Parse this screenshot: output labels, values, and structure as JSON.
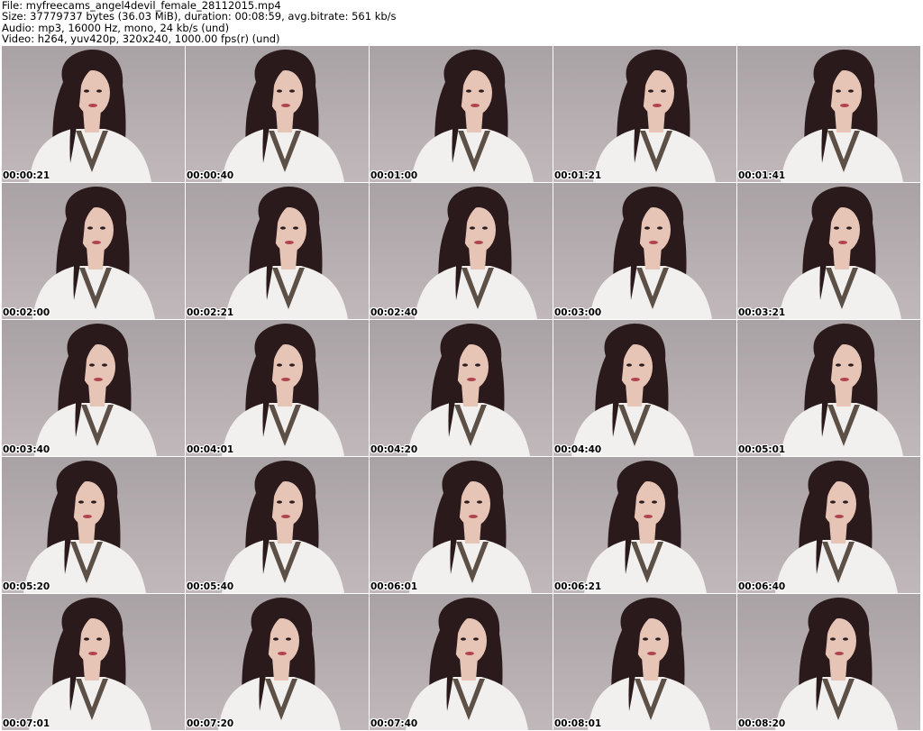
{
  "header": {
    "file": "File: myfreecams_angel4devil_female_28112015.mp4",
    "size": "Size: 37779737 bytes (36.03 MiB), duration: 00:08:59, avg.bitrate: 561 kb/s",
    "audio": "Audio: mp3, 16000 Hz, mono, 24 kb/s (und)",
    "video": "Video: h264, yuv420p, 320x240, 1000.00 fps(r) (und)"
  },
  "colors": {
    "background": "#ffffff",
    "wall": "#b3abad",
    "hair": "#2a1a1c",
    "robe": "#f2f0ee",
    "skin": "#e6c4b6",
    "trim": "#5b4f46"
  },
  "thumbnails": [
    {
      "time": "00:00:21"
    },
    {
      "time": "00:00:40"
    },
    {
      "time": "00:01:00"
    },
    {
      "time": "00:01:21"
    },
    {
      "time": "00:01:41"
    },
    {
      "time": "00:02:00"
    },
    {
      "time": "00:02:21"
    },
    {
      "time": "00:02:40"
    },
    {
      "time": "00:03:00"
    },
    {
      "time": "00:03:21"
    },
    {
      "time": "00:03:40"
    },
    {
      "time": "00:04:01"
    },
    {
      "time": "00:04:20"
    },
    {
      "time": "00:04:40"
    },
    {
      "time": "00:05:01"
    },
    {
      "time": "00:05:20"
    },
    {
      "time": "00:05:40"
    },
    {
      "time": "00:06:01"
    },
    {
      "time": "00:06:21"
    },
    {
      "time": "00:06:40"
    },
    {
      "time": "00:07:01"
    },
    {
      "time": "00:07:20"
    },
    {
      "time": "00:07:40"
    },
    {
      "time": "00:08:01"
    },
    {
      "time": "00:08:20"
    }
  ]
}
